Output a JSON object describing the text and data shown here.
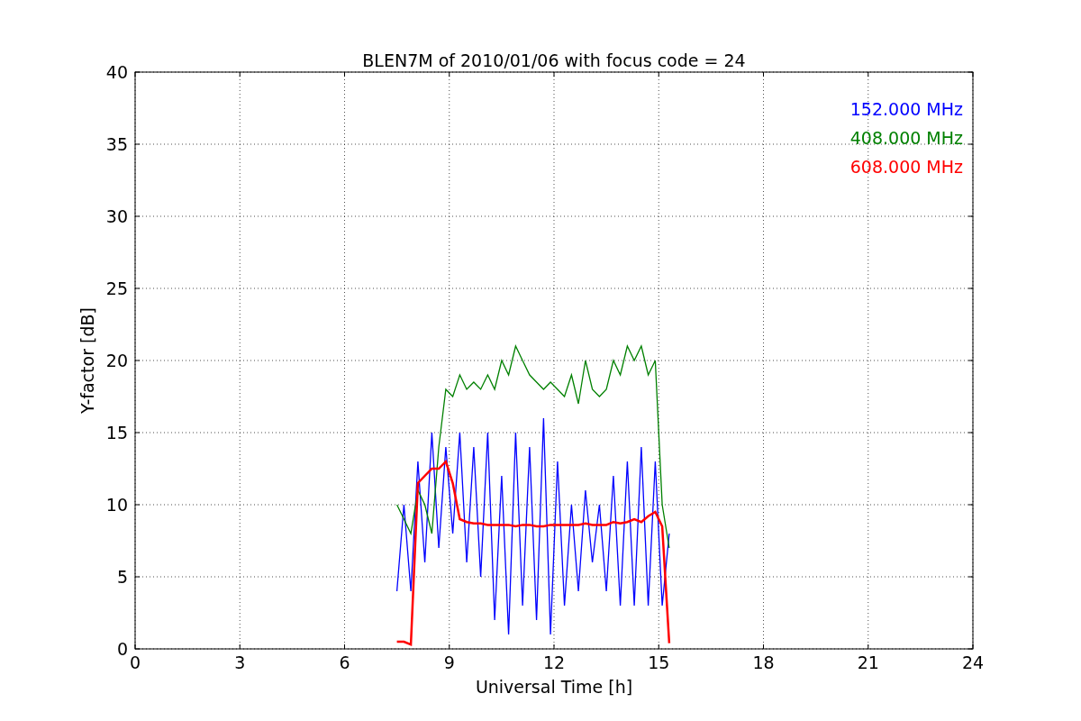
{
  "chart_data": {
    "type": "line",
    "title": "BLEN7M of 2010/01/06 with focus code = 24",
    "xlabel": "Universal Time [h]",
    "ylabel": "Y-factor [dB]",
    "x": [
      7.5,
      7.7,
      7.9,
      8.1,
      8.3,
      8.5,
      8.7,
      8.9,
      9.1,
      9.3,
      9.5,
      9.7,
      9.9,
      10.1,
      10.3,
      10.5,
      10.7,
      10.9,
      11.1,
      11.3,
      11.5,
      11.7,
      11.9,
      12.1,
      12.3,
      12.5,
      12.7,
      12.9,
      13.1,
      13.3,
      13.5,
      13.7,
      13.9,
      14.1,
      14.3,
      14.5,
      14.7,
      14.9,
      15.1,
      15.3
    ],
    "series": [
      {
        "name": "152.000 MHz",
        "color": "#0000ff",
        "values": [
          4,
          10,
          4,
          13,
          6,
          15,
          7,
          14,
          8,
          15,
          6,
          14,
          5,
          15,
          2,
          12,
          1,
          15,
          3,
          14,
          2,
          16,
          1,
          13,
          3,
          10,
          4,
          11,
          6,
          10,
          4,
          12,
          3,
          13,
          3,
          14,
          3,
          13,
          3,
          8
        ]
      },
      {
        "name": "408.000 MHz",
        "color": "#008000",
        "values": [
          10,
          9,
          8,
          11,
          10,
          8,
          14,
          18,
          17.5,
          19,
          18,
          18.5,
          18,
          19,
          18,
          20,
          19,
          21,
          20,
          19,
          18.5,
          18,
          18.5,
          18,
          17.5,
          19,
          17,
          20,
          18,
          17.5,
          18,
          20,
          19,
          21,
          20,
          21,
          19,
          20,
          10,
          7
        ]
      },
      {
        "name": "608.000 MHz",
        "color": "#ff0000",
        "values": [
          0.5,
          0.5,
          0.3,
          11.5,
          12,
          12.5,
          12.5,
          13,
          11.5,
          9,
          8.8,
          8.7,
          8.7,
          8.6,
          8.6,
          8.6,
          8.6,
          8.5,
          8.6,
          8.6,
          8.5,
          8.5,
          8.6,
          8.6,
          8.6,
          8.6,
          8.6,
          8.7,
          8.6,
          8.6,
          8.6,
          8.8,
          8.7,
          8.8,
          9,
          8.8,
          9.2,
          9.5,
          8.5,
          0.4
        ]
      }
    ],
    "xlim": [
      0,
      24
    ],
    "ylim": [
      0,
      40
    ],
    "xticks": [
      0,
      3,
      6,
      9,
      12,
      15,
      18,
      21,
      24
    ],
    "yticks": [
      0,
      5,
      10,
      15,
      20,
      25,
      30,
      35,
      40
    ],
    "grid": true
  }
}
